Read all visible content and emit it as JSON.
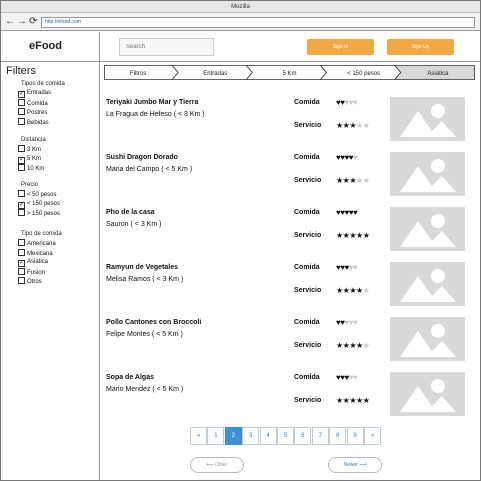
{
  "browser": {
    "title": "Mozilla",
    "url": "http://efood.com",
    "back_glyph": "←",
    "forward_glyph": "→",
    "reload_glyph": "⟳"
  },
  "header": {
    "logo": "eFood",
    "search_placeholder": "Search",
    "sign_in": "Sign In",
    "sign_up": "Sign Up",
    "accent_color": "#f2a944"
  },
  "sidebar": {
    "title": "Filters",
    "groups": [
      {
        "title": "Tipos de comida",
        "options": [
          {
            "label": "Entradas",
            "checked": true
          },
          {
            "label": "Comida",
            "checked": false
          },
          {
            "label": "Postres",
            "checked": false
          },
          {
            "label": "Bebidas",
            "checked": false
          }
        ]
      },
      {
        "title": "Distancia",
        "options": [
          {
            "label": "3 Km",
            "checked": false
          },
          {
            "label": "5 Km",
            "checked": true
          },
          {
            "label": "10 Km",
            "checked": false
          }
        ]
      },
      {
        "title": "Precio",
        "options": [
          {
            "label": "< 50 pesos",
            "checked": false
          },
          {
            "label": "< 150 pesos",
            "checked": true
          },
          {
            "label": "> 150 pesos",
            "checked": false
          }
        ]
      },
      {
        "title": "Tipo de comida",
        "options": [
          {
            "label": "Americana",
            "checked": false
          },
          {
            "label": "Mexicana",
            "checked": false
          },
          {
            "label": "Asiatica",
            "checked": true
          },
          {
            "label": "Fusion",
            "checked": false
          },
          {
            "label": "Otros",
            "checked": false
          }
        ]
      }
    ]
  },
  "breadcrumb": [
    "Filtros",
    "Entradas",
    "5 Km",
    "< 150 pesos",
    "Asiatica"
  ],
  "labels": {
    "comida": "Comida",
    "servicio": "Servicio"
  },
  "results": [
    {
      "dish": "Teriyaki Jumbo Mar y Tierra",
      "restaurant": "La Fragua de Hefeso ( < 3 Km )",
      "comida": 2,
      "servicio": 3
    },
    {
      "dish": "Sushi Dragon Dorado",
      "restaurant": "Maria del Campo ( < 5 Km )",
      "comida": 4,
      "servicio": 3
    },
    {
      "dish": "Pho de la casa",
      "restaurant": "Sauron ( < 3 Km )",
      "comida": 5,
      "servicio": 5
    },
    {
      "dish": "Ramyun de Vegetales",
      "restaurant": "Melisa Ramos ( < 3 Km )",
      "comida": 3,
      "servicio": 4
    },
    {
      "dish": "Pollo Cantones con Broccoli",
      "restaurant": "Felipe Montes ( < 5 Km )",
      "comida": 2,
      "servicio": 4
    },
    {
      "dish": "Sopa de Algas",
      "restaurant": "Mario Mendez ( < 5 Km )",
      "comida": 3,
      "servicio": 5
    }
  ],
  "rating_max": 5,
  "pagination": {
    "pages": [
      "«",
      "1",
      "2",
      "3",
      "4",
      "5",
      "6",
      "7",
      "8",
      "9",
      "»"
    ],
    "current": "2"
  },
  "nav": {
    "prev": "Older",
    "next": "Newer"
  }
}
